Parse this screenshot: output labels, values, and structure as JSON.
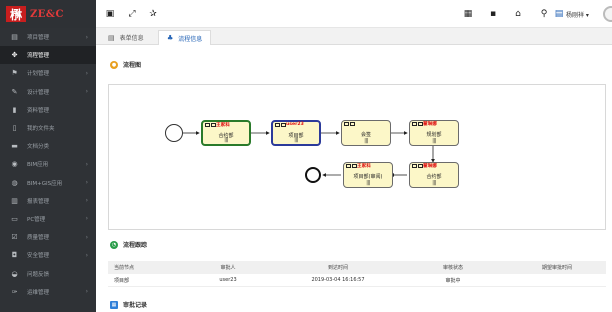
{
  "app": {
    "logo_mark": "㮊",
    "logo_text": "ZE&C",
    "user_name": "杨刚祥 ▾"
  },
  "topbar_icons": [
    "menu-toggle-icon",
    "expand-icon",
    "pin-icon",
    "calendar-icon",
    "grid-icon",
    "home-icon",
    "search-icon",
    "contacts-icon"
  ],
  "sidebar": {
    "items": [
      {
        "label": "项目管理",
        "icon": "document-icon",
        "has_children": true,
        "active": false
      },
      {
        "label": "流程管理",
        "icon": "flow-icon",
        "has_children": false,
        "active": true
      },
      {
        "label": "计划管理",
        "icon": "flag-icon",
        "has_children": true,
        "active": false
      },
      {
        "label": "设计管理",
        "icon": "pencil-icon",
        "has_children": true,
        "active": false
      },
      {
        "label": "资料管理",
        "icon": "file-icon",
        "has_children": false,
        "active": false
      },
      {
        "label": "我的文件夹",
        "icon": "folder-file-icon",
        "has_children": false,
        "active": false
      },
      {
        "label": "文档分类",
        "icon": "folder-icon",
        "has_children": false,
        "active": false
      },
      {
        "label": "BIM应用",
        "icon": "cube-icon",
        "has_children": true,
        "active": false
      },
      {
        "label": "BIM+GIS应用",
        "icon": "globe-icon",
        "has_children": true,
        "active": false
      },
      {
        "label": "报表管理",
        "icon": "report-icon",
        "has_children": true,
        "active": false
      },
      {
        "label": "PC管理",
        "icon": "pc-icon",
        "has_children": true,
        "active": false
      },
      {
        "label": "质量管理",
        "icon": "check-icon",
        "has_children": true,
        "active": false
      },
      {
        "label": "安全管理",
        "icon": "shield-icon",
        "has_children": true,
        "active": false
      },
      {
        "label": "问题反馈",
        "icon": "chat-icon",
        "has_children": false,
        "active": false
      },
      {
        "label": "运维管理",
        "icon": "wrench-icon",
        "has_children": true,
        "active": false
      }
    ]
  },
  "tabs": [
    {
      "label": "表单信息",
      "icon": "form-icon",
      "active": false
    },
    {
      "label": "流程信息",
      "icon": "sitemap-icon",
      "active": true
    }
  ],
  "flow_section": {
    "title": "流程图"
  },
  "flow_nodes": [
    {
      "who": "王家科",
      "label": "合约部",
      "bars": "|||"
    },
    {
      "who": "user23",
      "label": "项目部",
      "bars": "|||"
    },
    {
      "who": "",
      "label": "会签",
      "bars": "|||"
    },
    {
      "who": "翟琳娜",
      "label": "规划部",
      "bars": "|||"
    },
    {
      "who": "翟琳娜",
      "label": "合约部",
      "bars": "|||"
    },
    {
      "who": "王家科",
      "label": "项目部(审阅)",
      "bars": "|||"
    }
  ],
  "progress_section": {
    "title": "流程跟踪"
  },
  "progress_table": {
    "headers": [
      "当前节点",
      "审批人",
      "到达时间",
      "审核状态",
      "期望审批时间"
    ],
    "rows": [
      [
        "项目部",
        "user23",
        "2019-03-04 16:16:57",
        "审批中",
        ""
      ]
    ]
  },
  "records_section": {
    "title": "审批记录"
  },
  "colors": {
    "sidebar_bg": "#2f3236",
    "accent_blue": "#1e5fb4",
    "node_fill": "#fcf7c8",
    "node_current": "#2b3a9a",
    "node_done": "#2a7a2a",
    "flow_title_icon": "#e8a020",
    "progress_icon": "#2a9d4a",
    "records_icon": "#2f7fd8"
  }
}
